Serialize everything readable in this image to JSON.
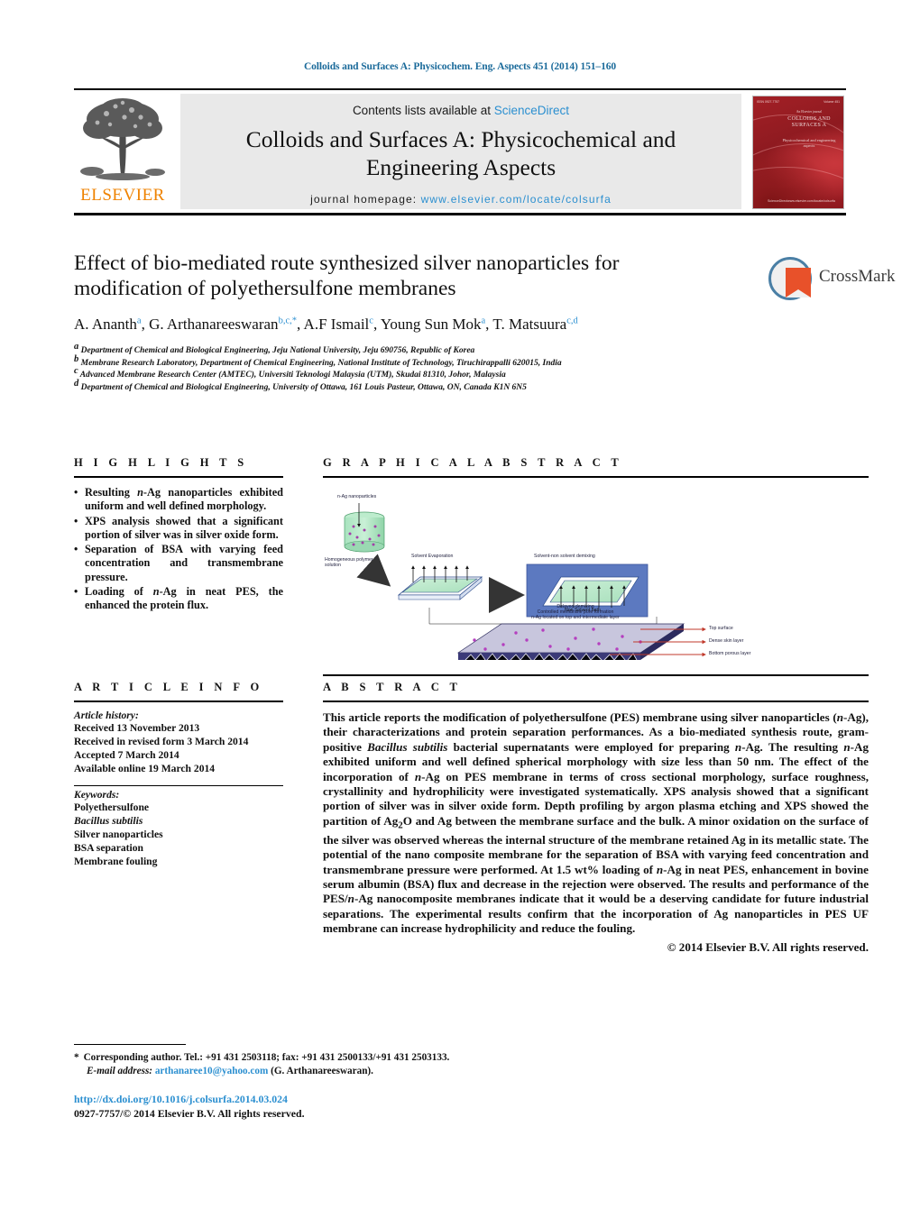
{
  "running_head": "Colloids and Surfaces A: Physicochem. Eng. Aspects 451 (2014) 151–160",
  "masthead": {
    "contents_prefix": "Contents lists available at ",
    "sciencedirect": "ScienceDirect",
    "journal_title_line1": "Colloids and Surfaces A: Physicochemical and",
    "journal_title_line2": "Engineering Aspects",
    "homepage_label": "journal homepage:",
    "homepage_url": "www.elsevier.com/locate/colsurfa",
    "publisher": "ELSEVIER",
    "cover": {
      "title": "COLLOIDS AND SURFACES A",
      "kicker": "An Elsevier journal",
      "subtitle": "Physicochemical and engineering aspects",
      "strip_left": "ISSN 0927-7757",
      "strip_right": "Volume 451",
      "bottom_left": "ScienceDirect",
      "bottom_right": "www.elsevier.com/locate/colsurfa"
    }
  },
  "article": {
    "title": "Effect of bio-mediated route synthesized silver nanoparticles for modification of polyethersulfone membranes",
    "authors": [
      {
        "name": "A. Ananth",
        "sup": "a",
        "sep": ", "
      },
      {
        "name": "G. Arthanareeswaran",
        "sup": "b,c,*",
        "sep": ", "
      },
      {
        "name": "A.F Ismail",
        "sup": "c",
        "sep": ", "
      },
      {
        "name": "Young Sun Mok",
        "sup": "a",
        "sep": ", "
      },
      {
        "name": "T. Matsuura",
        "sup": "c,d",
        "sep": ""
      }
    ],
    "affiliations": [
      {
        "marker": "a",
        "text": "Department of Chemical and Biological Engineering, Jeju National University, Jeju 690756, Republic of Korea"
      },
      {
        "marker": "b",
        "text": "Membrane Research Laboratory, Department of Chemical Engineering, National Institute of Technology, Tiruchirappalli 620015, India"
      },
      {
        "marker": "c",
        "text": "Advanced Membrane Research Center (AMTEC), Universiti Teknologi Malaysia (UTM), Skudai 81310, Johor, Malaysia"
      },
      {
        "marker": "d",
        "text": "Department of Chemical and Biological Engineering, University of Ottawa, 161 Louis Pasteur, Ottawa, ON, Canada K1N 6N5"
      }
    ],
    "crossmark_label": "CrossMark"
  },
  "highlights": {
    "heading": "H I G H L I G H T S",
    "items": [
      "Resulting n-Ag nanoparticles exhibited uniform and well defined morphology.",
      "XPS analysis showed that a significant portion of silver was in silver oxide form.",
      "Separation of BSA with varying feed concentration and transmembrane pressure.",
      "Loading of n-Ag in neat PES, the enhanced the protein flux."
    ]
  },
  "graphical_abstract": {
    "heading": "G R A P H I C A L   A B S T R A C T",
    "labels": {
      "nanoparticles": "n-Ag nanoparticles",
      "polymer_solution": "Homogeneous polymer\nsolution",
      "solvent_evaporation": "Solvent Evaporation",
      "demixing": "Solvent-non solvent demixing",
      "nonsolvent_bath": "Non Solvent bath",
      "delayed_line1": "Delayed demixing",
      "delayed_line2": "Controlled membrane pore formation",
      "delayed_line3": "n-Ag located on top and intermediate layer",
      "top_surface": "Top surface",
      "dense_skin": "Dense skin layer",
      "bottom_porous": "Bottom porous layer"
    }
  },
  "article_info": {
    "heading": "A R T I C L E   I N F O",
    "history_label": "Article history:",
    "history": [
      "Received 13 November 2013",
      "Received in revised form 3 March 2014",
      "Accepted 7 March 2014",
      "Available online 19 March 2014"
    ],
    "keywords_label": "Keywords:",
    "keywords": [
      {
        "text": "Polyethersulfone",
        "italic": false
      },
      {
        "text": "Bacillus subtilis",
        "italic": true
      },
      {
        "text": "Silver nanoparticles",
        "italic": false
      },
      {
        "text": "BSA separation",
        "italic": false
      },
      {
        "text": "Membrane fouling",
        "italic": false
      }
    ]
  },
  "abstract": {
    "heading": "A B S T R A C T",
    "text_parts": [
      {
        "t": "This article reports the modification of polyethersulfone (PES) membrane using silver nanoparticles (",
        "i": false
      },
      {
        "t": "n",
        "i": true
      },
      {
        "t": "-Ag), their characterizations and protein separation performances. As a bio-mediated synthesis route, gram-positive ",
        "i": false
      },
      {
        "t": "Bacillus subtilis",
        "i": true
      },
      {
        "t": " bacterial supernatants were employed for preparing ",
        "i": false
      },
      {
        "t": "n",
        "i": true
      },
      {
        "t": "-Ag. The resulting ",
        "i": false
      },
      {
        "t": "n",
        "i": true
      },
      {
        "t": "-Ag exhibited uniform and well defined spherical morphology with size less than 50 nm. The effect of the incorporation of ",
        "i": false
      },
      {
        "t": "n",
        "i": true
      },
      {
        "t": "-Ag on PES membrane in terms of cross sectional morphology, surface roughness, crystallinity and hydrophilicity were investigated systematically. XPS analysis showed that a significant portion of silver was in silver oxide form. Depth profiling by argon plasma etching and XPS showed the partition of Ag",
        "i": false
      },
      {
        "t": "2",
        "i": false,
        "sub": true
      },
      {
        "t": "O and Ag between the membrane surface and the bulk. A minor oxidation on the surface of the silver was observed whereas the internal structure of the membrane retained Ag in its metallic state. The potential of the nano composite membrane for the separation of BSA with varying feed concentration and transmembrane pressure were performed. At 1.5 wt% loading of ",
        "i": false
      },
      {
        "t": "n",
        "i": true
      },
      {
        "t": "-Ag in neat PES, enhancement in bovine serum albumin (BSA) flux and decrease in the rejection were observed. The results and performance of the PES/",
        "i": false
      },
      {
        "t": "n",
        "i": true
      },
      {
        "t": "-Ag nanocomposite membranes indicate that it would be a deserving candidate for future industrial separations. The experimental results confirm that the incorporation of Ag nanoparticles in PES UF membrane can increase hydrophilicity and reduce the fouling.",
        "i": false
      }
    ],
    "copyright": "© 2014 Elsevier B.V. All rights reserved."
  },
  "footer": {
    "corresponding": "Corresponding author. Tel.: +91 431 2503118; fax: +91 431 2500133/+91 431 2503133.",
    "email_label": "E-mail address:",
    "email": "arthanaree10@yahoo.com",
    "email_suffix": "(G. Arthanareeswaran).",
    "doi": "http://dx.doi.org/10.1016/j.colsurfa.2014.03.024",
    "issn_line": "0927-7757/© 2014 Elsevier B.V. All rights reserved."
  },
  "colors": {
    "link": "#2b8fd0",
    "runhead": "#1a6a9a",
    "elsevier_orange": "#ef8200",
    "cover_red": "#a32026"
  }
}
